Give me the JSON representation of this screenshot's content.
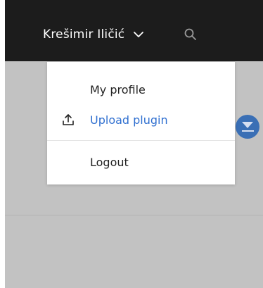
{
  "header": {
    "user_name": "Krešimir Iličić",
    "user_menu_icon": "chevron-down-icon",
    "search_icon": "search-icon"
  },
  "user_dropdown": {
    "items": [
      {
        "label": "My profile",
        "icon": null
      },
      {
        "label": "Upload plugin",
        "icon": "upload-icon",
        "color": "#2f6fd0"
      },
      {
        "label": "Logout",
        "icon": null
      }
    ]
  },
  "colors": {
    "topbar": "#1c1c1c",
    "page_background": "#c2c2c2",
    "accent": "#3a6fb5",
    "link": "#2f6fd0"
  }
}
